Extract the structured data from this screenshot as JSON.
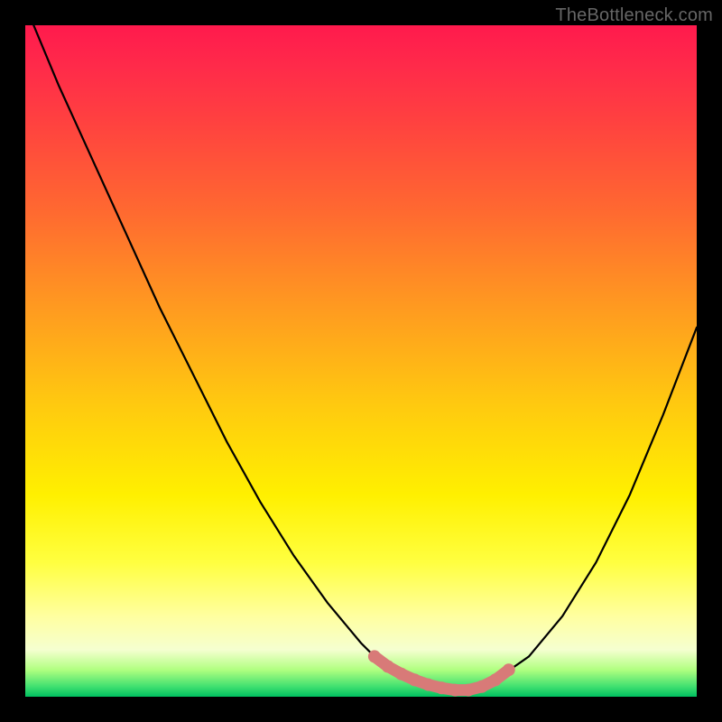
{
  "watermark": "TheBottleneck.com",
  "colors": {
    "frame_bg_top": "#ff1a4d",
    "frame_bg_bottom": "#00c060",
    "curve": "#000000",
    "marker_fill": "#d87a78",
    "marker_stroke": "#b85a58"
  },
  "chart_data": {
    "type": "line",
    "title": "",
    "xlabel": "",
    "ylabel": "",
    "xlim": [
      0,
      100
    ],
    "ylim": [
      0,
      100
    ],
    "grid": false,
    "series": [
      {
        "name": "bottleneck-curve",
        "x": [
          0,
          5,
          10,
          15,
          20,
          25,
          30,
          35,
          40,
          45,
          50,
          52,
          55,
          58,
          60,
          63,
          66,
          68,
          70,
          75,
          80,
          85,
          90,
          95,
          100
        ],
        "y": [
          103,
          91,
          80,
          69,
          58,
          48,
          38,
          29,
          21,
          14,
          8,
          6,
          4,
          2.5,
          1.8,
          1.2,
          1,
          1.5,
          2.5,
          6,
          12,
          20,
          30,
          42,
          55
        ]
      }
    ],
    "markers": {
      "name": "highlight-range",
      "x": [
        52,
        54,
        56,
        58,
        60,
        62,
        64,
        66,
        68,
        70,
        72
      ],
      "y": [
        6,
        4.5,
        3.4,
        2.5,
        1.8,
        1.3,
        1,
        1,
        1.5,
        2.5,
        4
      ]
    }
  }
}
